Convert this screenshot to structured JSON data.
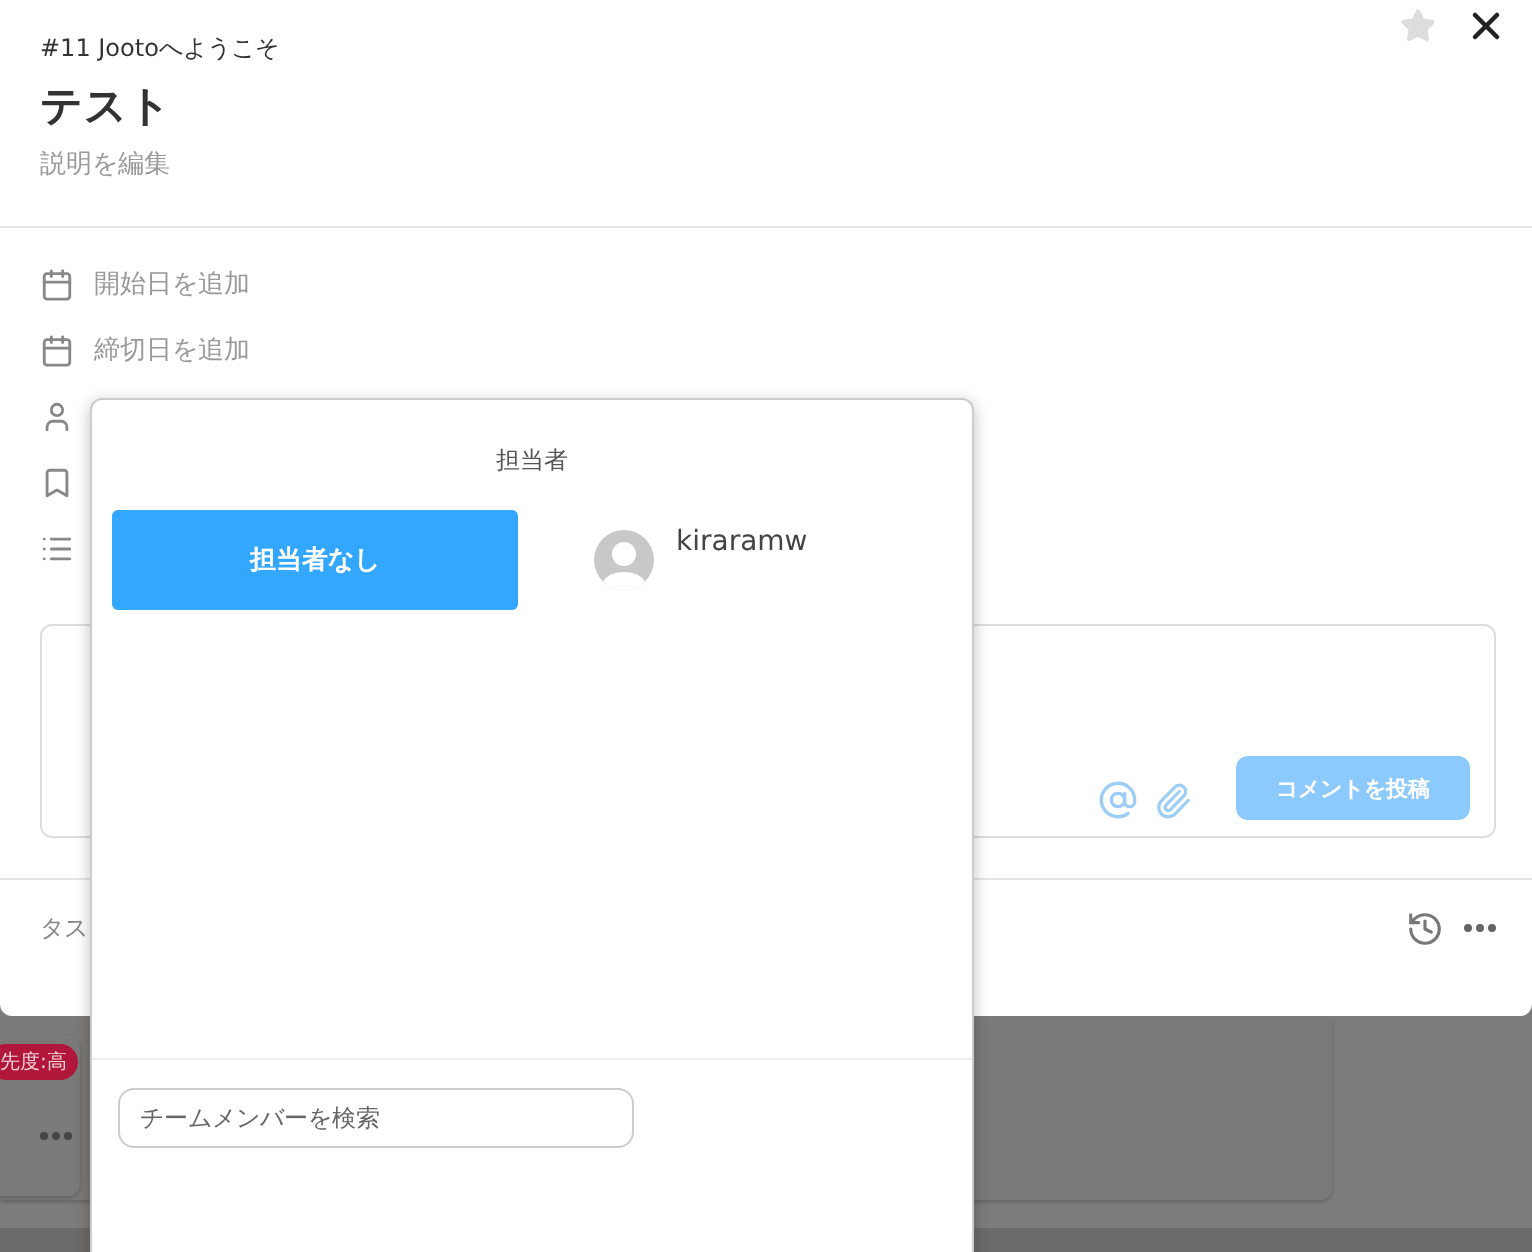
{
  "header": {
    "breadcrumb": "#11 Jootoへようこそ",
    "title": "テスト",
    "description": "説明を編集",
    "starred": false
  },
  "attributes": [
    {
      "kind": "calendar",
      "label": "開始日を追加"
    },
    {
      "kind": "calendar",
      "label": "締切日を追加"
    },
    {
      "kind": "person"
    },
    {
      "kind": "bookmark"
    },
    {
      "kind": "list"
    }
  ],
  "comment": {
    "submit": "コメントを投稿",
    "disabled": true
  },
  "footer": {
    "label": "タス"
  },
  "background": {
    "badge": "先度:高"
  },
  "assignee_popup": {
    "title": "担当者",
    "options": [
      {
        "kind": "none",
        "label": "担当者なし",
        "selected": true
      },
      {
        "kind": "member",
        "label": "kiraramw",
        "selected": false
      }
    ],
    "search": {
      "placeholder": "チームメンバーを検索"
    }
  }
}
